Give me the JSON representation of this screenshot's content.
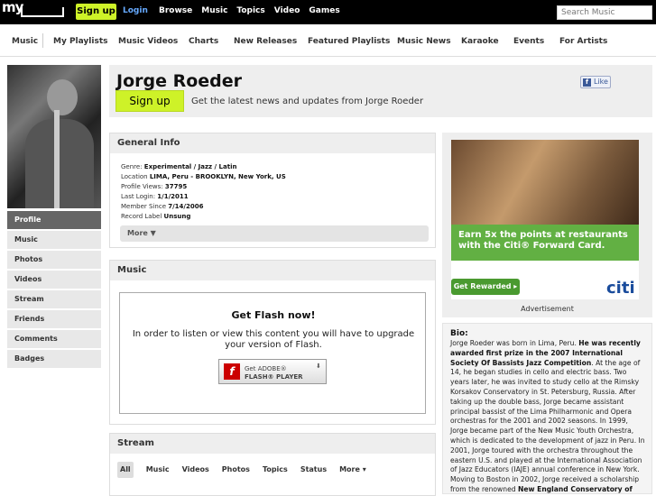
{
  "topbar": {
    "logo": "my",
    "signup": "Sign up",
    "login": "Login",
    "nav": [
      "Browse",
      "Music",
      "Topics",
      "Video",
      "Games"
    ],
    "search_placeholder": "Search Music"
  },
  "subnav": [
    "Music",
    "My Playlists",
    "Music Videos",
    "Charts",
    "New Releases",
    "Featured Playlists",
    "Music News",
    "Karaoke",
    "Events",
    "For Artists"
  ],
  "profile": {
    "name": "Jorge Roeder",
    "signup": "Sign up",
    "tagline": "Get the latest news and updates from Jorge Roeder",
    "like": "Like"
  },
  "left_menu": [
    "Profile",
    "Music",
    "Photos",
    "Videos",
    "Stream",
    "Friends",
    "Comments",
    "Badges"
  ],
  "general_info": {
    "title": "General Info",
    "genre_label": "Genre:",
    "genre": "Experimental / Jazz / Latin",
    "location_label": "Location",
    "location": "LIMA, Peru - BROOKLYN, New York, US",
    "views_label": "Profile Views:",
    "views": "37795",
    "login_label": "Last Login:",
    "login": "1/1/2011",
    "since_label": "Member Since",
    "since": "7/14/2006",
    "label_label": "Record Label",
    "label": "Unsung",
    "more": "More ▼"
  },
  "music": {
    "title": "Music",
    "flash_title": "Get Flash now!",
    "flash_text": "In order to listen or view this content you will have to upgrade your version of Flash.",
    "flash_btn_line1": "Get ADOBE®",
    "flash_btn_line2": "FLASH® PLAYER"
  },
  "stream": {
    "title": "Stream",
    "tabs": [
      "All",
      "Music",
      "Videos",
      "Photos",
      "Topics",
      "Status",
      "More ▾"
    ]
  },
  "ad": {
    "headline": "Earn 5x the points at restaurants with the Citi® Forward Card.",
    "button": "Get Rewarded ▸",
    "brand": "citi",
    "caption": "Advertisement"
  },
  "bio": {
    "title": "Bio:",
    "p1": "Jorge Roeder was born in Lima, Peru. ",
    "p1b": "He was recently awarded first prize in the 2007 International Society Of Bassists Jazz Competition",
    "p2": ". At the age of 14, he began studies in cello and electric bass. Two years later, he was invited to study cello at the Rimsky Korsakov Conservatory in St. Petersburg, Russia. After taking up the double bass, Jorge became assistant principal bassist of the Lima Philharmonic and Opera orchestras for the 2001 and 2002 seasons. In 1999, Jorge became part of the New Music Youth Orchestra, which is dedicated to the development of jazz in Peru. In 2001, Jorge toured with the orchestra throughout the eastern U.S. and played at the International Association of Jazz Educators (IAJE) annual conference in New York. Moving to Boston in 2002, Jorge received a scholarship from the renowned ",
    "p2b": "New England Conservatory of"
  }
}
